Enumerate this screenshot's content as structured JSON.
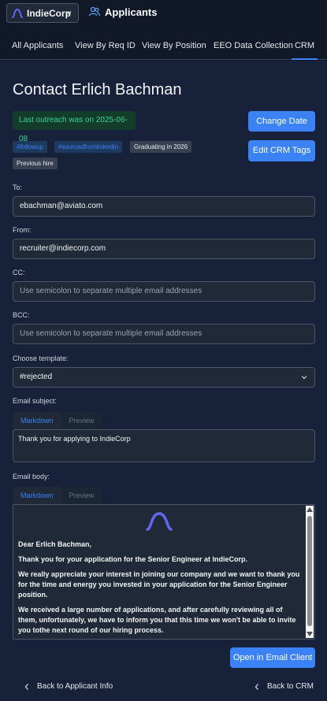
{
  "header": {
    "org_name": "IndieCorp",
    "app_title": "Applicants"
  },
  "tabs": [
    {
      "label": "All Applicants"
    },
    {
      "label": "View By Req ID"
    },
    {
      "label": "View By Position"
    },
    {
      "label": "EEO Data Collection"
    },
    {
      "label": "CRM",
      "active": true
    }
  ],
  "contact": {
    "title": "Contact Erlich Bachman",
    "outreach": "Last outreach was on 2025-06-08",
    "change_date_label": "Change Date",
    "edit_tags_label": "Edit CRM Tags",
    "tags": [
      "#followup",
      "#sourcedfromlinkedin",
      "Graduating in 2026",
      "Previous hire"
    ]
  },
  "form": {
    "to_label": "To:",
    "to_value": "ebachman@aviato.com",
    "from_label": "From:",
    "from_value": "recruiter@indiecorp.com",
    "cc_label": "CC:",
    "cc_placeholder": "Use semicolon to separate multiple email addresses",
    "bcc_label": "BCC:",
    "bcc_placeholder": "Use semicolon to separate multiple email addresses",
    "template_label": "Choose template:",
    "template_value": "#rejected",
    "subject_label": "Email subject:",
    "subject_value": "Thank you for applying to IndieCorp",
    "body_label": "Email body:",
    "markdown_tab": "Markdown",
    "preview_tab": "Preview"
  },
  "email_body": {
    "greeting": "Dear Erlich Bachman,",
    "p1": "Thank you for your application for the Senior Engineer at IndieCorp.",
    "p2": "We really appreciate your interest in joining our company and we want to thank you for the time and energy you invested in your application for the Senior Engineer position.",
    "p3": "We received a large number of applications, and after carefully reviewing all of them, unfortunately, we have to inform you that this time we won't be able to invite you tothe next round of our hiring process."
  },
  "actions": {
    "open_email_label": "Open in Email Client",
    "back_applicant_label": "Back to Applicant Info",
    "back_crm_label": "Back to CRM"
  },
  "colors": {
    "accent": "#3b82f6",
    "background": "#111827",
    "panel": "#17213a",
    "success_text": "#34d399",
    "brand_logo": "#6366f1"
  },
  "icons": {
    "org_logo": "indiecorp-logo-icon",
    "applicants": "users-icon",
    "dropdown": "chevron-down-icon",
    "back": "chevron-left-icon"
  }
}
